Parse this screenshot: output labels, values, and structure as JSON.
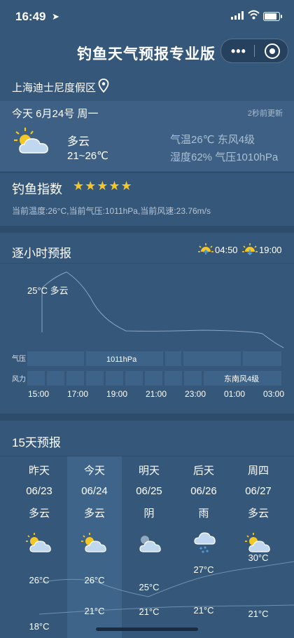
{
  "status_bar": {
    "time": "16:49"
  },
  "header": {
    "title": "钓鱼天气预报专业版",
    "menu_label": "•••"
  },
  "location": {
    "name": "上海迪士尼度假区"
  },
  "today": {
    "date_label": "今天 6月24号 周一",
    "updated": "2秒前更新",
    "condition": "多云",
    "range": "21~26℃",
    "temp_wind": "气温26℃ 东风4级",
    "humidity_pressure": "湿度62% 气压1010hPa",
    "icon": "partly-cloudy-icon"
  },
  "fishing": {
    "title": "钓鱼指数",
    "stars": "★★★★★",
    "summary": "当前温度:26°C,当前气压:1011hPa,当前风速:23.76m/s"
  },
  "hourly": {
    "title": "逐小时预报",
    "sunrise": "04:50",
    "sunset": "19:00",
    "temp_label": "25°C 多云",
    "pressure_row_label": "气压",
    "pressure_value": "1011hPa",
    "wind_row_label": "风力",
    "wind_value": "东南风4级",
    "times": [
      "15:00",
      "17:00",
      "19:00",
      "21:00",
      "23:00",
      "01:00",
      "03:00"
    ]
  },
  "daily": {
    "title": "15天预报",
    "days": [
      {
        "name": "昨天",
        "date": "06/23",
        "cond": "多云",
        "icon": "partly-cloudy-icon",
        "hi": "26°C",
        "lo": "18°C"
      },
      {
        "name": "今天",
        "date": "06/24",
        "cond": "多云",
        "icon": "partly-cloudy-icon",
        "hi": "26°C",
        "lo": "21°C"
      },
      {
        "name": "明天",
        "date": "06/25",
        "cond": "阴",
        "icon": "overcast-icon",
        "hi": "25°C",
        "lo": "21°C"
      },
      {
        "name": "后天",
        "date": "06/26",
        "cond": "雨",
        "icon": "rain-icon",
        "hi": "27°C",
        "lo": "21°C"
      },
      {
        "name": "周四",
        "date": "06/27",
        "cond": "多云",
        "icon": "partly-cloudy-icon",
        "hi": "30°C",
        "lo": "21°C"
      }
    ]
  },
  "colors": {
    "background": "#35577a",
    "panel": "#3d6084",
    "star": "#f4c728",
    "muted_text": "#a9c1d6"
  }
}
